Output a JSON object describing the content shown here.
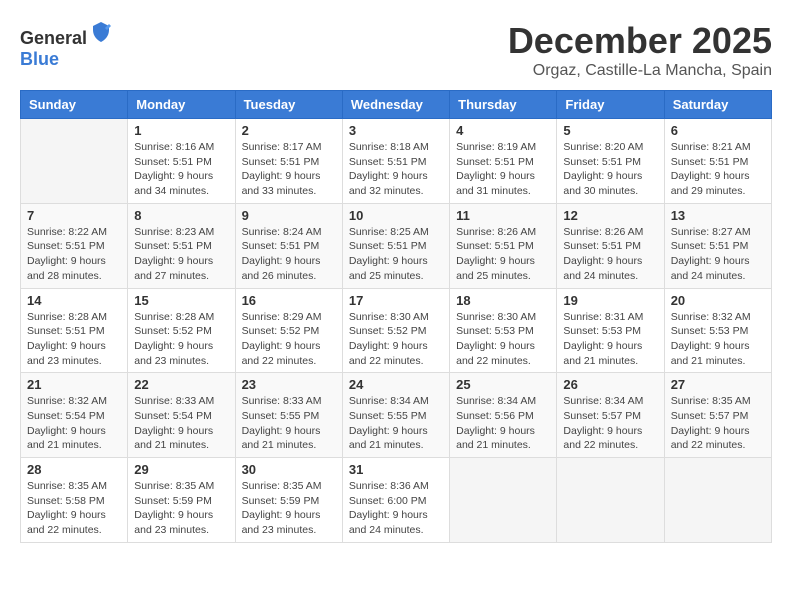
{
  "logo": {
    "text_general": "General",
    "text_blue": "Blue"
  },
  "title": {
    "month": "December 2025",
    "location": "Orgaz, Castille-La Mancha, Spain"
  },
  "days_of_week": [
    "Sunday",
    "Monday",
    "Tuesday",
    "Wednesday",
    "Thursday",
    "Friday",
    "Saturday"
  ],
  "weeks": [
    [
      {
        "day": "",
        "info": ""
      },
      {
        "day": "1",
        "info": "Sunrise: 8:16 AM\nSunset: 5:51 PM\nDaylight: 9 hours\nand 34 minutes."
      },
      {
        "day": "2",
        "info": "Sunrise: 8:17 AM\nSunset: 5:51 PM\nDaylight: 9 hours\nand 33 minutes."
      },
      {
        "day": "3",
        "info": "Sunrise: 8:18 AM\nSunset: 5:51 PM\nDaylight: 9 hours\nand 32 minutes."
      },
      {
        "day": "4",
        "info": "Sunrise: 8:19 AM\nSunset: 5:51 PM\nDaylight: 9 hours\nand 31 minutes."
      },
      {
        "day": "5",
        "info": "Sunrise: 8:20 AM\nSunset: 5:51 PM\nDaylight: 9 hours\nand 30 minutes."
      },
      {
        "day": "6",
        "info": "Sunrise: 8:21 AM\nSunset: 5:51 PM\nDaylight: 9 hours\nand 29 minutes."
      }
    ],
    [
      {
        "day": "7",
        "info": "Sunrise: 8:22 AM\nSunset: 5:51 PM\nDaylight: 9 hours\nand 28 minutes."
      },
      {
        "day": "8",
        "info": "Sunrise: 8:23 AM\nSunset: 5:51 PM\nDaylight: 9 hours\nand 27 minutes."
      },
      {
        "day": "9",
        "info": "Sunrise: 8:24 AM\nSunset: 5:51 PM\nDaylight: 9 hours\nand 26 minutes."
      },
      {
        "day": "10",
        "info": "Sunrise: 8:25 AM\nSunset: 5:51 PM\nDaylight: 9 hours\nand 25 minutes."
      },
      {
        "day": "11",
        "info": "Sunrise: 8:26 AM\nSunset: 5:51 PM\nDaylight: 9 hours\nand 25 minutes."
      },
      {
        "day": "12",
        "info": "Sunrise: 8:26 AM\nSunset: 5:51 PM\nDaylight: 9 hours\nand 24 minutes."
      },
      {
        "day": "13",
        "info": "Sunrise: 8:27 AM\nSunset: 5:51 PM\nDaylight: 9 hours\nand 24 minutes."
      }
    ],
    [
      {
        "day": "14",
        "info": "Sunrise: 8:28 AM\nSunset: 5:51 PM\nDaylight: 9 hours\nand 23 minutes."
      },
      {
        "day": "15",
        "info": "Sunrise: 8:28 AM\nSunset: 5:52 PM\nDaylight: 9 hours\nand 23 minutes."
      },
      {
        "day": "16",
        "info": "Sunrise: 8:29 AM\nSunset: 5:52 PM\nDaylight: 9 hours\nand 22 minutes."
      },
      {
        "day": "17",
        "info": "Sunrise: 8:30 AM\nSunset: 5:52 PM\nDaylight: 9 hours\nand 22 minutes."
      },
      {
        "day": "18",
        "info": "Sunrise: 8:30 AM\nSunset: 5:53 PM\nDaylight: 9 hours\nand 22 minutes."
      },
      {
        "day": "19",
        "info": "Sunrise: 8:31 AM\nSunset: 5:53 PM\nDaylight: 9 hours\nand 21 minutes."
      },
      {
        "day": "20",
        "info": "Sunrise: 8:32 AM\nSunset: 5:53 PM\nDaylight: 9 hours\nand 21 minutes."
      }
    ],
    [
      {
        "day": "21",
        "info": "Sunrise: 8:32 AM\nSunset: 5:54 PM\nDaylight: 9 hours\nand 21 minutes."
      },
      {
        "day": "22",
        "info": "Sunrise: 8:33 AM\nSunset: 5:54 PM\nDaylight: 9 hours\nand 21 minutes."
      },
      {
        "day": "23",
        "info": "Sunrise: 8:33 AM\nSunset: 5:55 PM\nDaylight: 9 hours\nand 21 minutes."
      },
      {
        "day": "24",
        "info": "Sunrise: 8:34 AM\nSunset: 5:55 PM\nDaylight: 9 hours\nand 21 minutes."
      },
      {
        "day": "25",
        "info": "Sunrise: 8:34 AM\nSunset: 5:56 PM\nDaylight: 9 hours\nand 21 minutes."
      },
      {
        "day": "26",
        "info": "Sunrise: 8:34 AM\nSunset: 5:57 PM\nDaylight: 9 hours\nand 22 minutes."
      },
      {
        "day": "27",
        "info": "Sunrise: 8:35 AM\nSunset: 5:57 PM\nDaylight: 9 hours\nand 22 minutes."
      }
    ],
    [
      {
        "day": "28",
        "info": "Sunrise: 8:35 AM\nSunset: 5:58 PM\nDaylight: 9 hours\nand 22 minutes."
      },
      {
        "day": "29",
        "info": "Sunrise: 8:35 AM\nSunset: 5:59 PM\nDaylight: 9 hours\nand 23 minutes."
      },
      {
        "day": "30",
        "info": "Sunrise: 8:35 AM\nSunset: 5:59 PM\nDaylight: 9 hours\nand 23 minutes."
      },
      {
        "day": "31",
        "info": "Sunrise: 8:36 AM\nSunset: 6:00 PM\nDaylight: 9 hours\nand 24 minutes."
      },
      {
        "day": "",
        "info": ""
      },
      {
        "day": "",
        "info": ""
      },
      {
        "day": "",
        "info": ""
      }
    ]
  ]
}
